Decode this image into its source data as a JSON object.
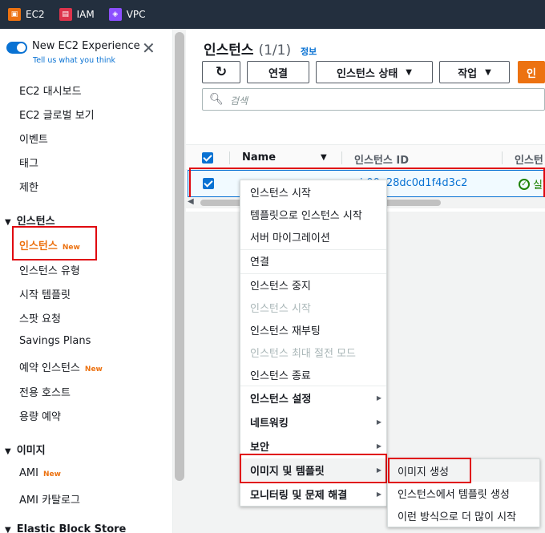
{
  "topbar": {
    "services": [
      {
        "label": "EC2",
        "icon": "ec2-service-icon",
        "color": "#ec7211"
      },
      {
        "label": "IAM",
        "icon": "iam-service-icon",
        "color": "#dd344c"
      },
      {
        "label": "VPC",
        "icon": "vpc-service-icon",
        "color": "#8c4fff"
      }
    ]
  },
  "sidebar": {
    "experience_title": "New EC2 Experience",
    "experience_sub": "Tell us what you think",
    "items_top": [
      "EC2 대시보드",
      "EC2 글로벌 보기",
      "이벤트",
      "태그",
      "제한"
    ],
    "section_instances": "인스턴스",
    "instances_items": [
      "인스턴스",
      "인스턴스 유형",
      "시작 템플릿",
      "스팟 요청",
      "Savings Plans",
      "예약 인스턴스",
      "전용 호스트",
      "용량 예약"
    ],
    "new_badge": "New",
    "section_images": "이미지",
    "images_items": [
      "AMI",
      "AMI 카탈로그"
    ],
    "section_ebs": "Elastic Block Store"
  },
  "main": {
    "title": "인스턴스",
    "count": "(1/1)",
    "info": "정보",
    "buttons": {
      "connect": "연결",
      "state": "인스턴스 상태",
      "actions": "작업",
      "launch": "인"
    },
    "search_placeholder": "검색",
    "columns": [
      "Name",
      "인스턴스 ID",
      "인스턴"
    ],
    "row": {
      "name": "",
      "instance_id": "i-00e28dc0d1f4d3c2",
      "status": "실행"
    }
  },
  "context_menu": {
    "items": [
      {
        "label": "인스턴스 시작",
        "disabled": false
      },
      {
        "label": "템플릿으로 인스턴스 시작",
        "disabled": false
      },
      {
        "label": "서버 마이그레이션",
        "disabled": false
      },
      {
        "label": "연결",
        "disabled": false
      },
      {
        "label": "인스턴스 중지",
        "disabled": false
      },
      {
        "label": "인스턴스 시작",
        "disabled": true
      },
      {
        "label": "인스턴스 재부팅",
        "disabled": false
      },
      {
        "label": "인스턴스 최대 절전 모드",
        "disabled": true
      },
      {
        "label": "인스턴스 종료",
        "disabled": false
      },
      {
        "label": "인스턴스 설정",
        "submenu": true
      },
      {
        "label": "네트워킹",
        "submenu": true
      },
      {
        "label": "보안",
        "submenu": true
      },
      {
        "label": "이미지 및 템플릿",
        "submenu": true
      },
      {
        "label": "모니터링 및 문제 해결",
        "submenu": true
      }
    ]
  },
  "submenu": {
    "items": [
      "이미지 생성",
      "인스턴스에서 템플릿 생성",
      "이런 방식으로 더 많이 시작"
    ]
  },
  "colors": {
    "accent": "#0972d3",
    "orange": "#ec7211",
    "highlight": "#e0070f",
    "topbar": "#232f3e"
  }
}
